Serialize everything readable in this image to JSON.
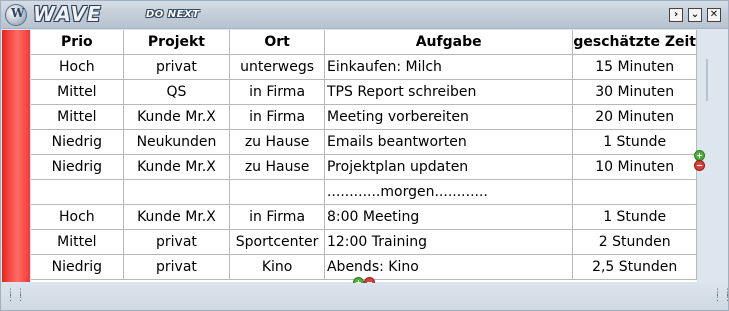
{
  "window": {
    "brand": "WAVE",
    "subtitle": "DO NEXT",
    "controls": {
      "menu": "›",
      "dropdown": "⌄",
      "close": "✕"
    }
  },
  "table": {
    "headers": {
      "prio": "Prio",
      "projekt": "Projekt",
      "ort": "Ort",
      "aufgabe": "Aufgabe",
      "zeit": "geschätzte Zeit"
    },
    "rows": [
      {
        "prio": "Hoch",
        "projekt": "privat",
        "ort": "unterwegs",
        "aufgabe": "Einkaufen: Milch",
        "zeit": "15 Minuten"
      },
      {
        "prio": "Mittel",
        "projekt": "QS",
        "ort": "in Firma",
        "aufgabe": "TPS Report schreiben",
        "zeit": "30 Minuten"
      },
      {
        "prio": "Mittel",
        "projekt": "Kunde Mr.X",
        "ort": "in Firma",
        "aufgabe": "Meeting vorbereiten",
        "zeit": "20 Minuten"
      },
      {
        "prio": "Niedrig",
        "projekt": "Neukunden",
        "ort": "zu Hause",
        "aufgabe": "Emails beantworten",
        "zeit": "1 Stunde"
      },
      {
        "prio": "Niedrig",
        "projekt": "Kunde Mr.X",
        "ort": "zu Hause",
        "aufgabe": "Projektplan updaten",
        "zeit": "10 Minuten"
      },
      {
        "prio": "",
        "projekt": "",
        "ort": "",
        "aufgabe": "............morgen............",
        "zeit": ""
      },
      {
        "prio": "Hoch",
        "projekt": "Kunde Mr.X",
        "ort": "in Firma",
        "aufgabe": "8:00 Meeting",
        "zeit": "1 Stunde"
      },
      {
        "prio": "Mittel",
        "projekt": "privat",
        "ort": "Sportcenter",
        "aufgabe": "12:00 Training",
        "zeit": "2 Stunden"
      },
      {
        "prio": "Niedrig",
        "projekt": "privat",
        "ort": "Kino",
        "aufgabe": "Abends: Kino",
        "zeit": "2,5 Stunden"
      }
    ]
  },
  "controls": {
    "plus": "+",
    "minus": "−"
  },
  "colors": {
    "accent_bar": "#f23a35",
    "frame": "#dde6ee"
  }
}
